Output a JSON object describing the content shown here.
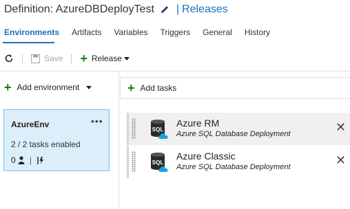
{
  "header": {
    "definition_title": "Definition: AzureDBDeployTest",
    "separator": "|",
    "releases_link": "Releases"
  },
  "tabs": [
    {
      "label": "Environments",
      "active": true
    },
    {
      "label": "Artifacts"
    },
    {
      "label": "Variables"
    },
    {
      "label": "Triggers"
    },
    {
      "label": "General"
    },
    {
      "label": "History"
    }
  ],
  "toolbar": {
    "save_label": "Save",
    "release_label": "Release"
  },
  "environments_panel": {
    "add_environment_label": "Add environment",
    "environment": {
      "name": "AzureEnv",
      "menu": "•••",
      "tasks_enabled": "2 / 2 tasks enabled",
      "approvers_count": "0",
      "meta_separator": "|"
    }
  },
  "tasks_panel": {
    "add_tasks_label": "Add tasks",
    "tasks": [
      {
        "name": "Azure RM",
        "subtitle": "Azure SQL Database Deployment",
        "icon": "sql-database-icon",
        "selected": true
      },
      {
        "name": "Azure Classic",
        "subtitle": "Azure SQL Database Deployment",
        "icon": "sql-database-icon",
        "selected": false
      }
    ],
    "remove_glyph": "✕"
  },
  "colors": {
    "accent": "#1e6fbb",
    "add_green": "#107c10",
    "env_card_bg": "#dbeefa",
    "env_card_border": "#7fbfe8"
  }
}
